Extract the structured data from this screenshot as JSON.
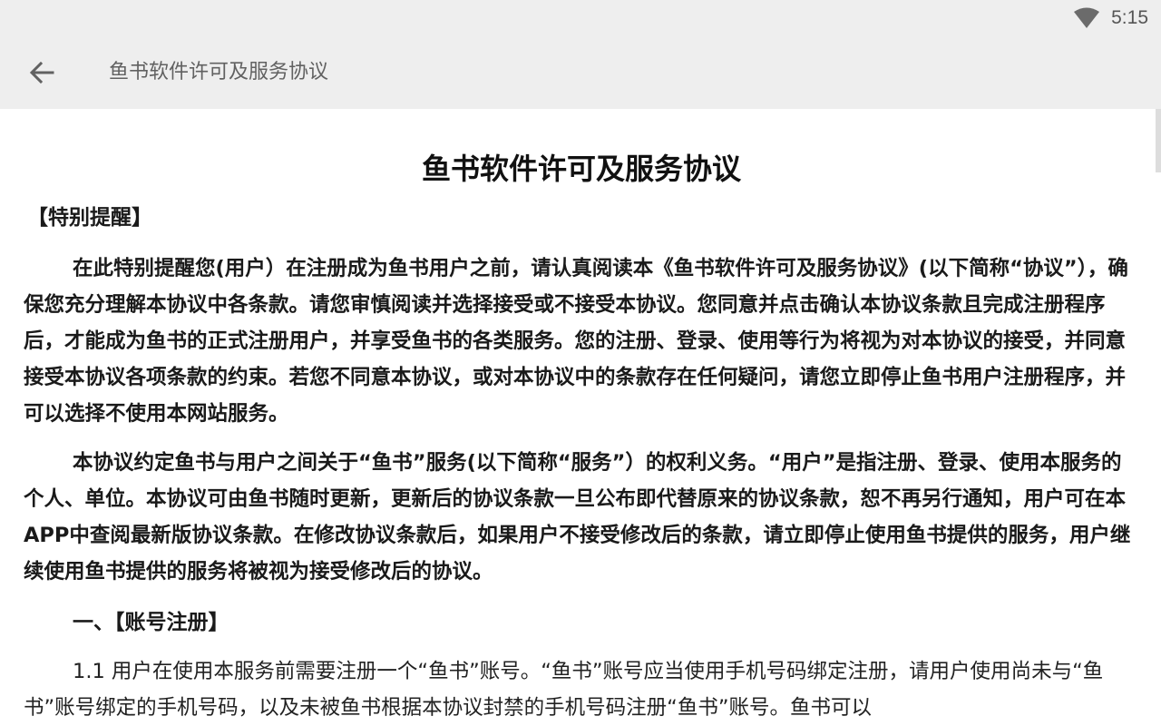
{
  "status_bar": {
    "time": "5:15",
    "wifi_icon": "wifi-icon"
  },
  "app_bar": {
    "back_icon": "arrow-left-icon",
    "title": "鱼书软件许可及服务协议"
  },
  "document": {
    "title": "鱼书软件许可及服务协议",
    "special_reminder_label": "【特别提醒】",
    "paragraph_1": "在此特别提醒您(用户）在注册成为鱼书用户之前，请认真阅读本《鱼书软件许可及服务协议》(以下简称“协议”），确保您充分理解本协议中各条款。请您审慎阅读并选择接受或不接受本协议。您同意并点击确认本协议条款且完成注册程序后，才能成为鱼书的正式注册用户，并享受鱼书的各类服务。您的注册、登录、使用等行为将视为对本协议的接受，并同意接受本协议各项条款的约束。若您不同意本协议，或对本协议中的条款存在任何疑问，请您立即停止鱼书用户注册程序，并可以选择不使用本网站服务。",
    "paragraph_2": "本协议约定鱼书与用户之间关于“鱼书”服务(以下简称“服务”）的权利义务。“用户”是指注册、登录、使用本服务的个人、单位。本协议可由鱼书随时更新，更新后的协议条款一旦公布即代替原来的协议条款，恕不再另行通知，用户可在本APP中查阅最新版协议条款。在修改协议条款后，如果用户不接受修改后的条款，请立即停止使用鱼书提供的服务，用户继续使用鱼书提供的服务将被视为接受修改后的协议。",
    "section_1_heading": "一、【账号注册】",
    "paragraph_3": "1.1 用户在使用本服务前需要注册一个“鱼书”账号。“鱼书”账号应当使用手机号码绑定注册，请用户使用尚未与“鱼书”账号绑定的手机号码，以及未被鱼书根据本协议封禁的手机号码注册“鱼书”账号。鱼书可以"
  },
  "colors": {
    "app_bar_bg": "#eeeeee",
    "title_text": "#616161",
    "body_text": "#1a1a1a"
  }
}
